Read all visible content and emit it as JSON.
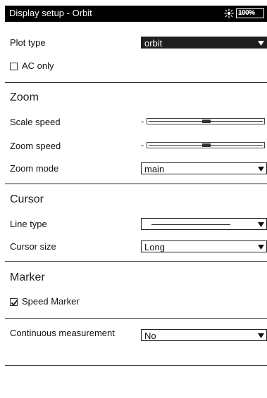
{
  "window": {
    "title": "Display setup - Orbit",
    "battery_text": "100%"
  },
  "plot_type": {
    "label": "Plot type",
    "value": "orbit"
  },
  "ac_only": {
    "label": "AC only",
    "checked": false
  },
  "zoom": {
    "heading": "Zoom",
    "scale_speed_label": "Scale speed",
    "zoom_speed_label": "Zoom speed",
    "slider_min_text": "-",
    "zoom_mode_label": "Zoom mode",
    "zoom_mode_value": "main"
  },
  "cursor": {
    "heading": "Cursor",
    "line_type_label": "Line type",
    "cursor_size_label": "Cursor size",
    "cursor_size_value": "Long"
  },
  "marker": {
    "heading": "Marker",
    "speed_marker_label": "Speed Marker",
    "speed_marker_checked": true
  },
  "continuous": {
    "label": "Continuous measurement",
    "value": "No"
  }
}
